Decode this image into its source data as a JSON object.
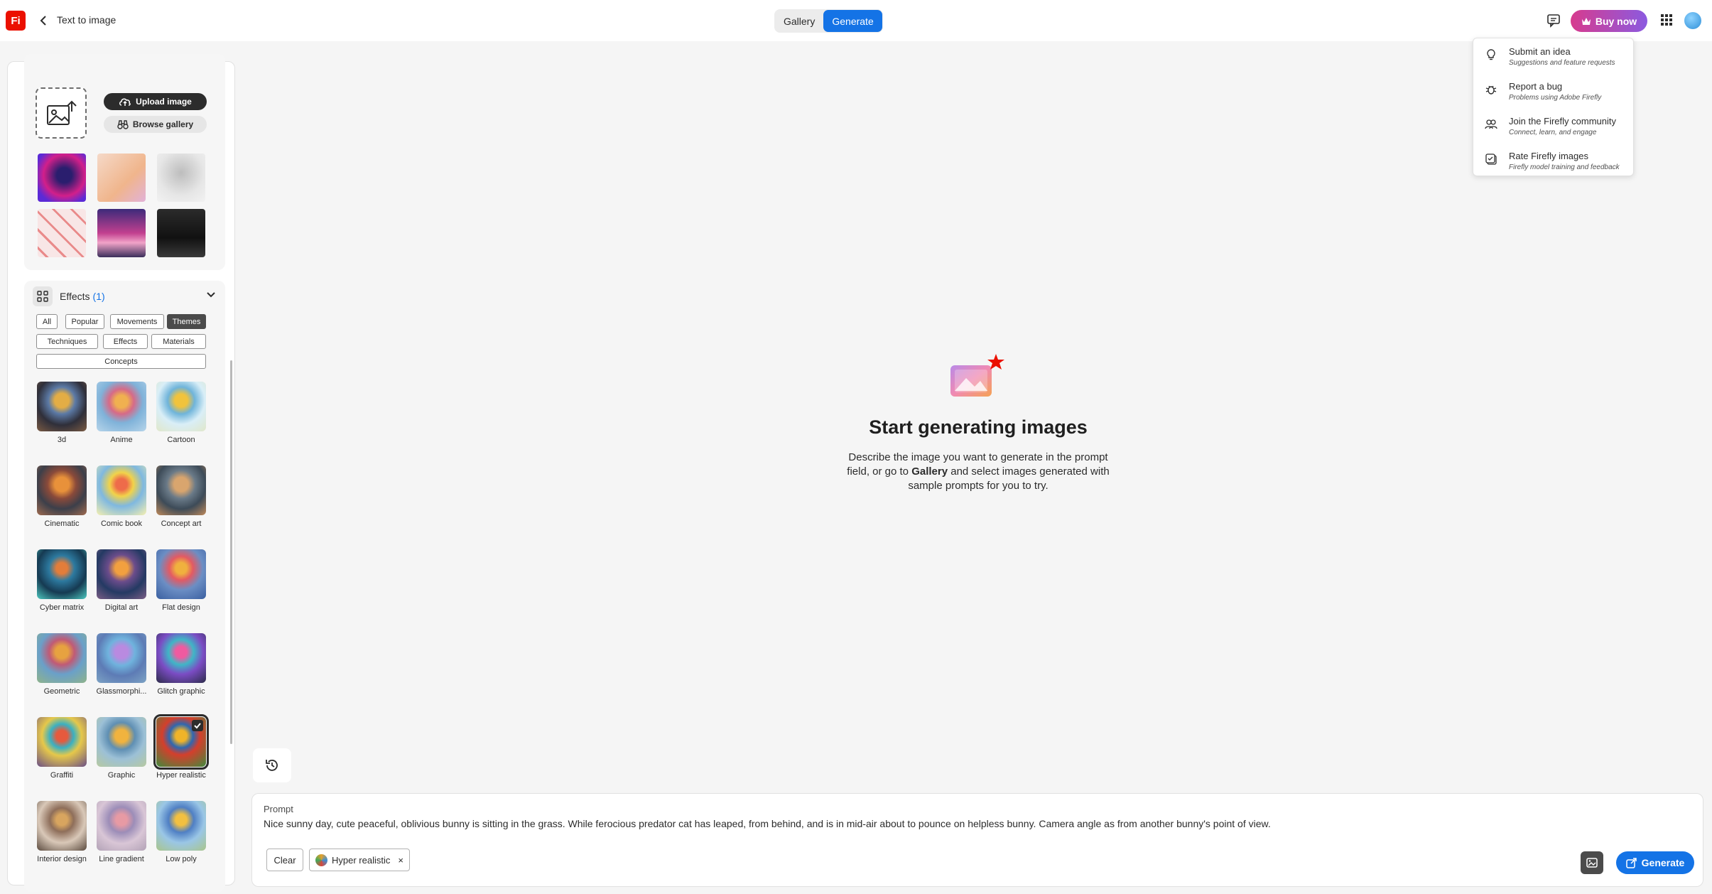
{
  "app": {
    "logo_text": "Fi",
    "page_title": "Text to image"
  },
  "header": {
    "tabs": [
      {
        "label": "Gallery",
        "active": false
      },
      {
        "label": "Generate",
        "active": true
      }
    ],
    "buy_label": "Buy now",
    "accent_color": "#1473e6"
  },
  "menu": {
    "items": [
      {
        "title": "Submit an idea",
        "subtitle": "Suggestions and feature requests",
        "icon": "lightbulb-icon"
      },
      {
        "title": "Report a bug",
        "subtitle": "Problems using Adobe Firefly",
        "icon": "bug-icon"
      },
      {
        "title": "Join the Firefly community",
        "subtitle": "Connect, learn, and engage",
        "icon": "community-icon"
      },
      {
        "title": "Rate Firefly images",
        "subtitle": "Firefly model training and feedback",
        "icon": "rate-icon"
      }
    ]
  },
  "sidebar": {
    "upload_label": "Upload image",
    "browse_label": "Browse gallery",
    "effects_title": "Effects",
    "effects_count": "(1)",
    "filters": [
      {
        "label": "All",
        "active": false
      },
      {
        "label": "Popular",
        "active": false
      },
      {
        "label": "Movements",
        "active": false
      },
      {
        "label": "Themes",
        "active": true
      },
      {
        "label": "Techniques",
        "active": false
      },
      {
        "label": "Effects",
        "active": false
      },
      {
        "label": "Materials",
        "active": false
      },
      {
        "label": "Concepts",
        "active": false
      }
    ],
    "styles": [
      {
        "label": "3d",
        "selected": false
      },
      {
        "label": "Anime",
        "selected": false
      },
      {
        "label": "Cartoon",
        "selected": false
      },
      {
        "label": "Cinematic",
        "selected": false
      },
      {
        "label": "Comic book",
        "selected": false
      },
      {
        "label": "Concept art",
        "selected": false
      },
      {
        "label": "Cyber matrix",
        "selected": false
      },
      {
        "label": "Digital art",
        "selected": false
      },
      {
        "label": "Flat design",
        "selected": false
      },
      {
        "label": "Geometric",
        "selected": false
      },
      {
        "label": "Glassmorphi...",
        "selected": false
      },
      {
        "label": "Glitch graphic",
        "selected": false
      },
      {
        "label": "Graffiti",
        "selected": false
      },
      {
        "label": "Graphic",
        "selected": false
      },
      {
        "label": "Hyper realistic",
        "selected": true
      },
      {
        "label": "Interior design",
        "selected": false
      },
      {
        "label": "Line gradient",
        "selected": false
      },
      {
        "label": "Low poly",
        "selected": false
      }
    ]
  },
  "main": {
    "empty_title": "Start generating images",
    "empty_desc_1": "Describe the image you want to generate in the prompt field, or go to ",
    "empty_desc_bold": "Gallery",
    "empty_desc_2": " and select images generated with sample prompts for you to try."
  },
  "prompt": {
    "label": "Prompt",
    "text": "Nice sunny day, cute peaceful, oblivious bunny is sitting in the grass. While ferocious predator cat has leaped, from behind, and is in mid-air about to pounce on helpless bunny. Camera angle as from another bunny's point of view.",
    "clear_label": "Clear",
    "chip_label": "Hyper realistic",
    "chip_close": "×",
    "generate_label": "Generate"
  }
}
